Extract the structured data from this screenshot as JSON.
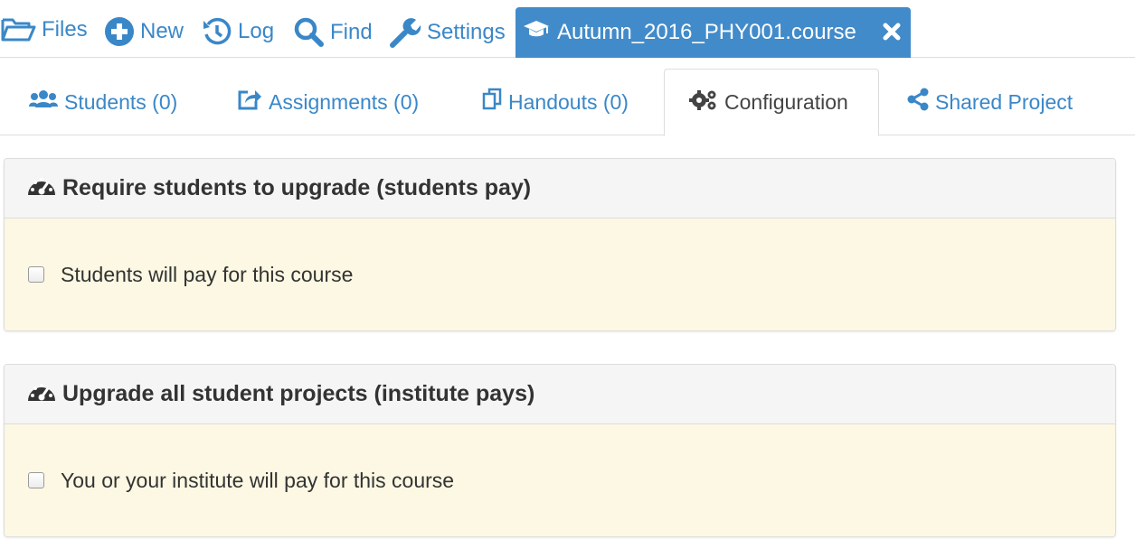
{
  "topbar": {
    "files": {
      "label": "Files",
      "icon": "folder-open-icon"
    },
    "new": {
      "label": "New",
      "icon": "plus-circle-icon"
    },
    "log": {
      "label": "Log",
      "icon": "history-icon"
    },
    "find": {
      "label": "Find",
      "icon": "search-icon"
    },
    "settings": {
      "label": "Settings",
      "icon": "wrench-icon"
    },
    "active_tab": {
      "label": "Autumn_2016_PHY001.course",
      "icon": "graduation-cap-icon",
      "close_icon": "close-icon"
    }
  },
  "tabs": [
    {
      "label": "Students (0)",
      "icon": "users-icon"
    },
    {
      "label": "Assignments (0)",
      "icon": "share-square-icon"
    },
    {
      "label": "Handouts (0)",
      "icon": "copy-icon"
    },
    {
      "label": "Configuration",
      "icon": "cogs-icon",
      "active": true
    },
    {
      "label": "Shared Project",
      "icon": "share-alt-icon"
    }
  ],
  "panels": [
    {
      "title": "Require students to upgrade (students pay)",
      "icon": "dashboard-icon",
      "checkbox_label": "Students will pay for this course",
      "checked": false
    },
    {
      "title": "Upgrade all student projects (institute pays)",
      "icon": "dashboard-icon",
      "checkbox_label": "You or your institute will pay for this course",
      "checked": false
    }
  ],
  "colors": {
    "link": "#3a87c8",
    "active_tab_bg": "#428bca",
    "panel_header_bg": "#f5f5f5",
    "panel_body_bg": "#fcf8e3"
  }
}
